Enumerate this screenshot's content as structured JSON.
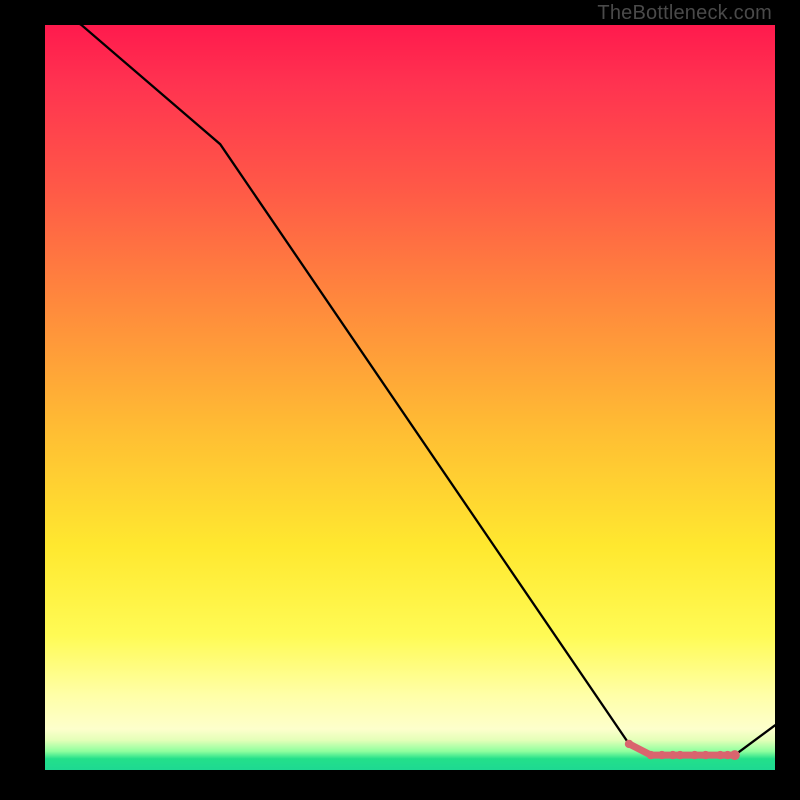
{
  "watermark": "TheBottleneck.com",
  "colors": {
    "background": "#000000",
    "line": "#000000",
    "marker": "#d9646e",
    "gradient_top": "#ff1a4d",
    "gradient_bottom": "#1ed992"
  },
  "chart_data": {
    "type": "line",
    "title": "",
    "xlabel": "",
    "ylabel": "",
    "xlim": [
      0,
      100
    ],
    "ylim": [
      0,
      100
    ],
    "grid": false,
    "legend": false,
    "x": [
      0,
      5,
      24,
      80,
      83,
      84.5,
      86,
      87,
      89,
      90.5,
      92.5,
      93.5,
      94.5,
      100
    ],
    "values": [
      103,
      100,
      84,
      3.5,
      2,
      2,
      2,
      2,
      2,
      2,
      2,
      2,
      2,
      6
    ],
    "markers": {
      "x": [
        80,
        83,
        84.5,
        86,
        87,
        89,
        90.5,
        92.5,
        93.5,
        94.5
      ],
      "y": [
        3.5,
        2,
        2,
        2,
        2,
        2,
        2,
        2,
        2,
        2
      ],
      "note": "short flat pink segment with dense dots near the bottom-right"
    }
  }
}
